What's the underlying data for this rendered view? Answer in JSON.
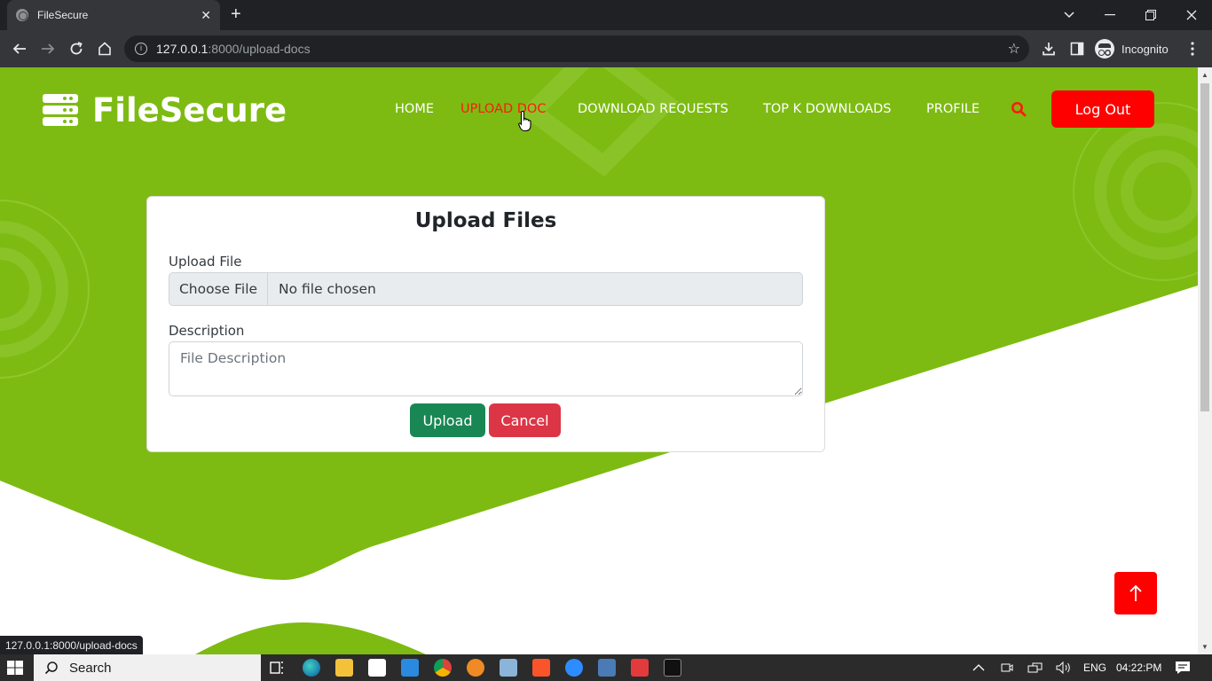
{
  "browser": {
    "tab_title": "FileSecure",
    "url_host": "127.0.0.1",
    "url_path": ":8000/upload-docs",
    "incognito_label": "Incognito",
    "status_url": "127.0.0.1:8000/upload-docs"
  },
  "site": {
    "brand": "FileSecure",
    "nav": [
      {
        "label": "HOME"
      },
      {
        "label": "UPLOAD DOC"
      },
      {
        "label": "DOWNLOAD REQUESTS"
      },
      {
        "label": "TOP K DOWNLOADS"
      },
      {
        "label": "PROFILE"
      }
    ],
    "logout_label": "Log Out"
  },
  "form": {
    "title": "Upload Files",
    "file_label": "Upload File",
    "choose_label": "Choose File",
    "no_file_label": "No file chosen",
    "description_label": "Description",
    "description_placeholder": "File Description",
    "upload_label": "Upload",
    "cancel_label": "Cancel"
  },
  "taskbar": {
    "search_placeholder": "Search",
    "language": "ENG",
    "time": "04:22:PM"
  },
  "colors": {
    "brand_green": "#7dbb12",
    "accent_red": "#ff0000",
    "upload_green": "#198754",
    "cancel_red": "#dc3545"
  }
}
